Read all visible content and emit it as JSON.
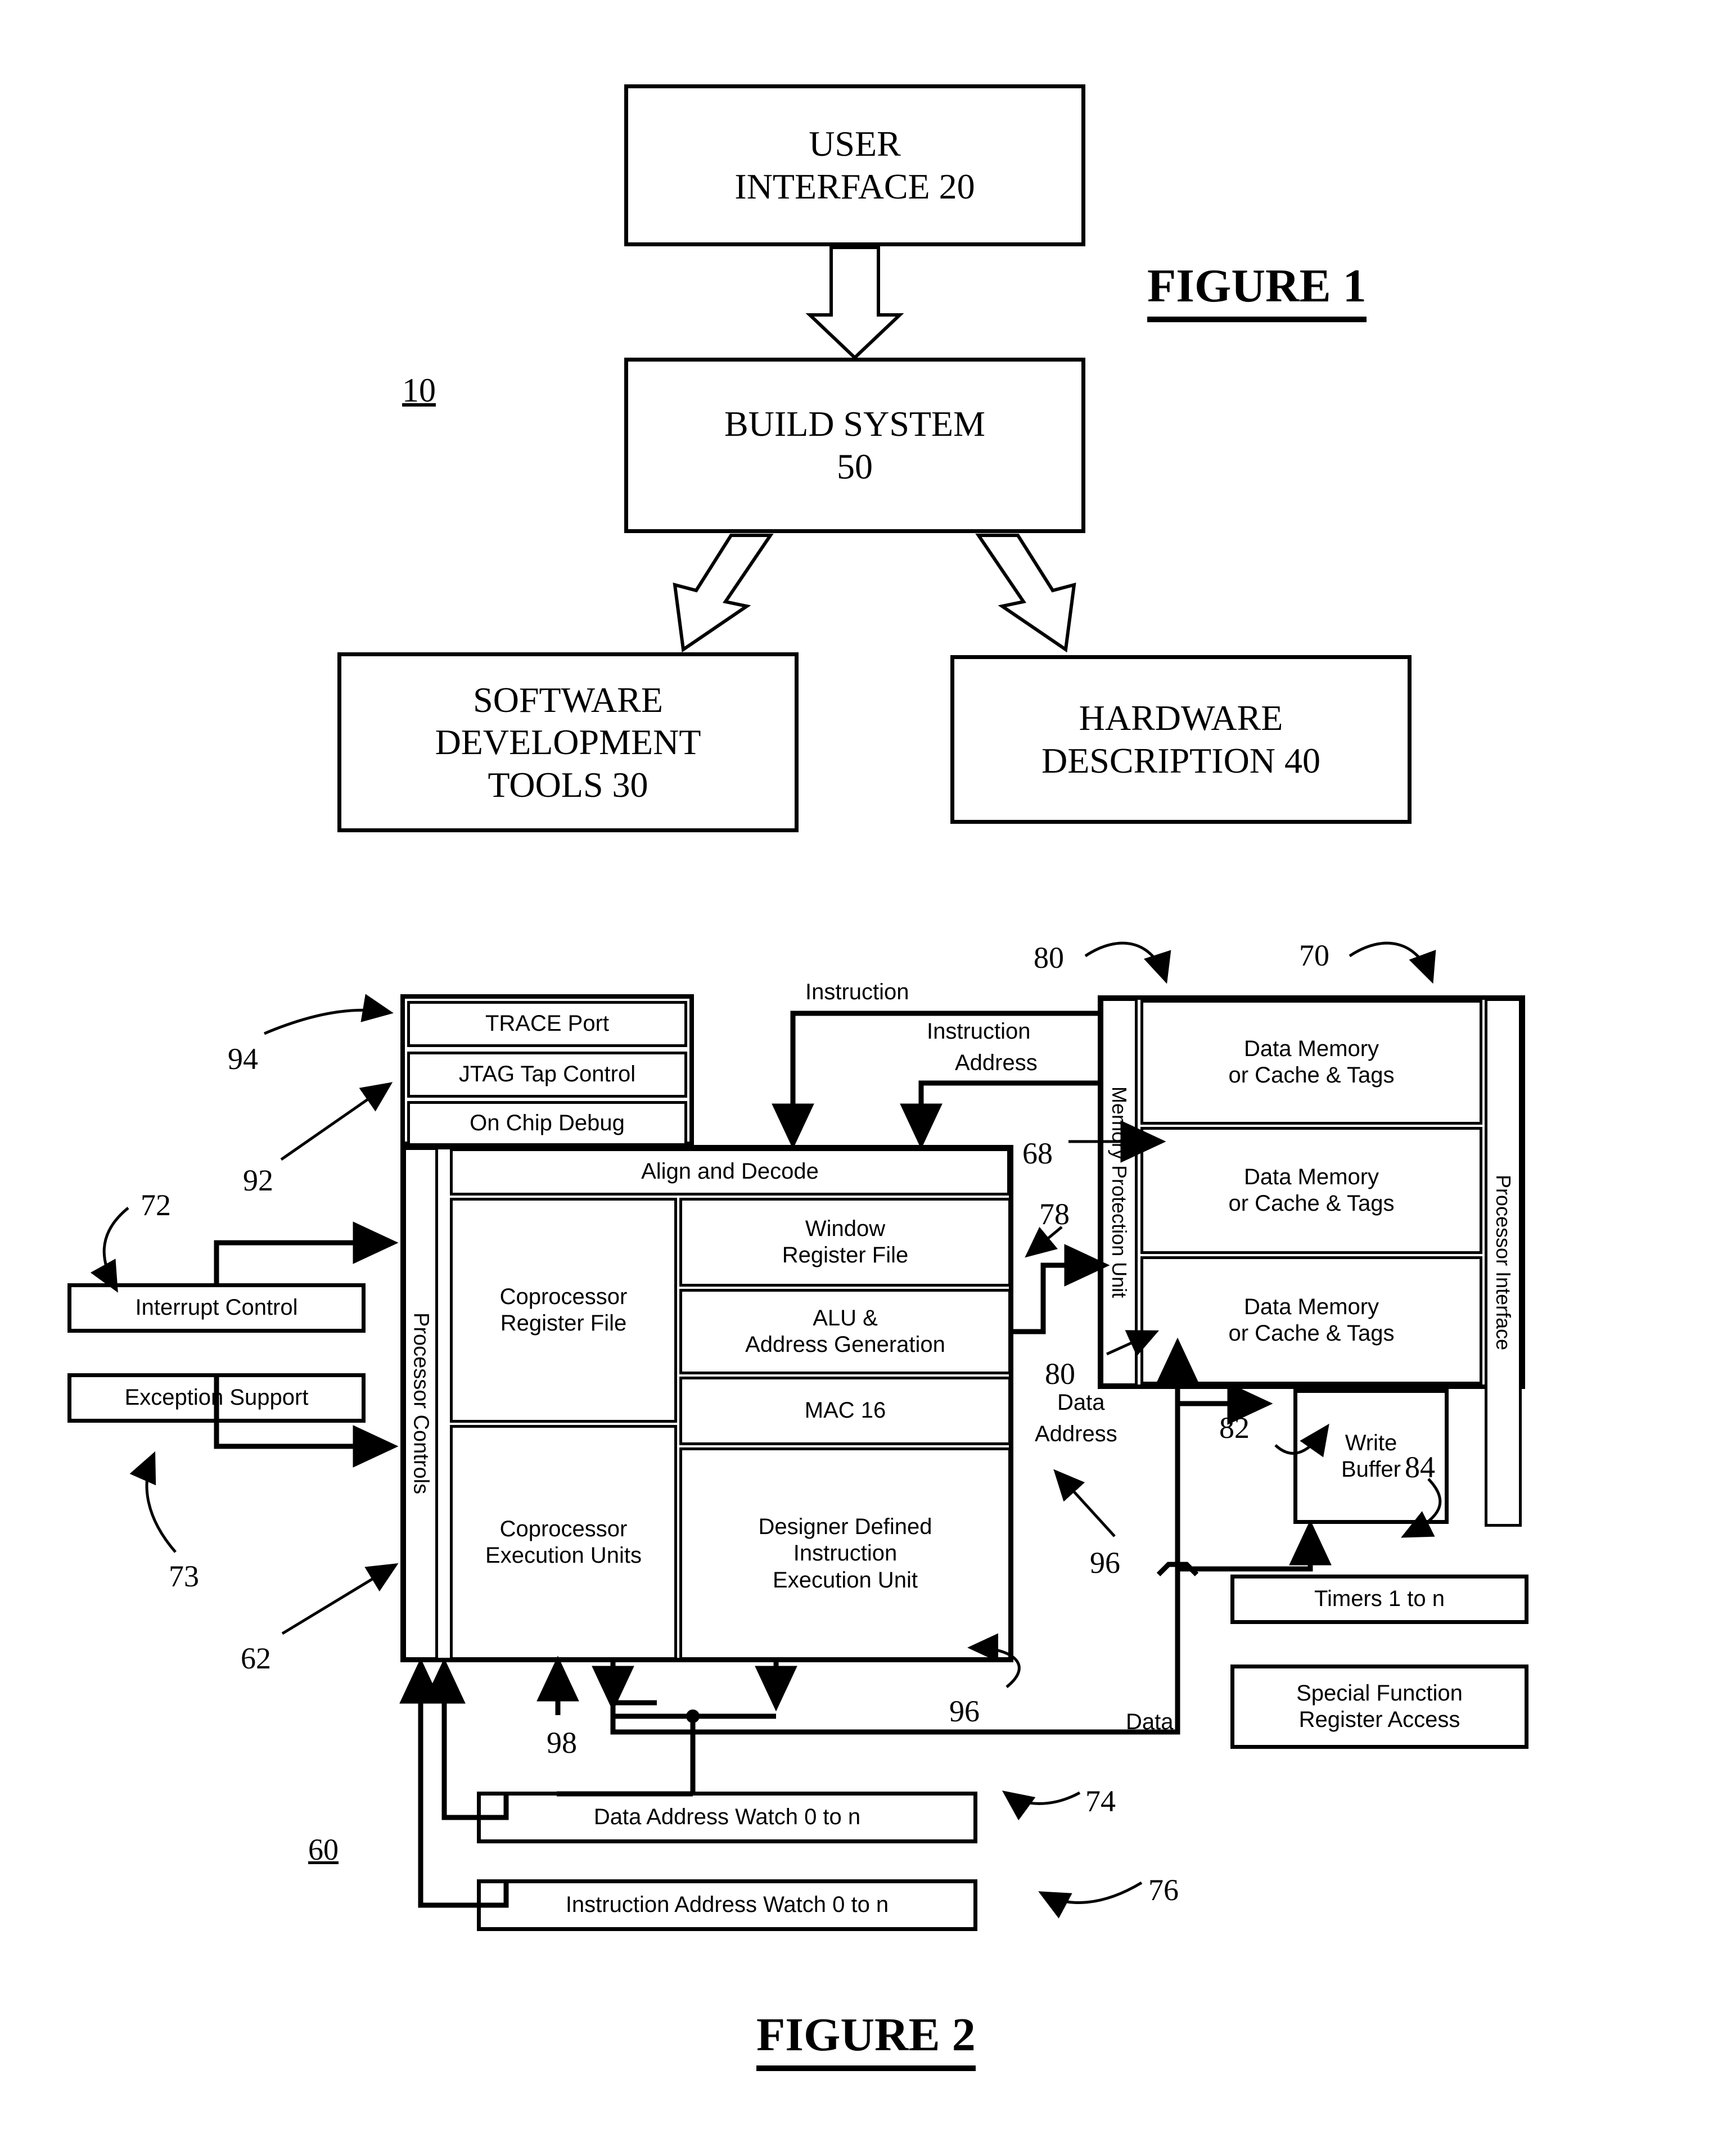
{
  "figure1": {
    "title": "FIGURE 1",
    "ref_system": "10",
    "boxes": {
      "user_interface": "USER\nINTERFACE 20",
      "user_interface_l1": "USER",
      "user_interface_l2": "INTERFACE 20",
      "build_system_l1": "BUILD SYSTEM",
      "build_system_l2": "50",
      "software_tools_l1": "SOFTWARE",
      "software_tools_l2": "DEVELOPMENT",
      "software_tools_l3": "TOOLS 30",
      "hardware_desc_l1": "HARDWARE",
      "hardware_desc_l2": "DESCRIPTION 40"
    }
  },
  "figure2": {
    "title": "FIGURE 2",
    "ref_processor": "60",
    "debug": {
      "trace_port": "TRACE Port",
      "jtag_tap_control": "JTAG Tap Control",
      "on_chip_debug": "On Chip Debug"
    },
    "core": {
      "processor_controls": "Processor Controls",
      "align_and_decode": "Align and Decode",
      "coprocessor_register_file_l1": "Coprocessor",
      "coprocessor_register_file_l2": "Register File",
      "coprocessor_execution_units_l1": "Coprocessor",
      "coprocessor_execution_units_l2": "Execution Units",
      "window_register_file_l1": "Window",
      "window_register_file_l2": "Register File",
      "alu_address_generation_l1": "ALU &",
      "alu_address_generation_l2": "Address Generation",
      "mac16": "MAC 16",
      "designer_defined_l1": "Designer Defined",
      "designer_defined_l2": "Instruction",
      "designer_defined_l3": "Execution Unit"
    },
    "memory": {
      "memory_protection_unit": "Memory Protection Unit",
      "processor_interface": "Processor Interface",
      "data_memory_1_l1": "Data Memory",
      "data_memory_1_l2": "or Cache & Tags",
      "data_memory_2_l1": "Data Memory",
      "data_memory_2_l2": "or Cache & Tags",
      "data_memory_3_l1": "Data Memory",
      "data_memory_3_l2": "or Cache & Tags",
      "write_buffer_l1": "Write",
      "write_buffer_l2": "Buffer"
    },
    "peripherals": {
      "timers": "Timers 1 to n",
      "special_function_l1": "Special Function",
      "special_function_l2": "Register Access",
      "data_address_watch": "Data Address Watch 0 to n",
      "instruction_address_watch": "Instruction Address Watch 0 to n",
      "interrupt_control": "Interrupt Control",
      "exception_support": "Exception Support"
    },
    "signal_labels": {
      "instruction": "Instruction",
      "instruction_address_l1": "Instruction",
      "instruction_address_l2": "Address",
      "data_address_l1": "Data",
      "data_address_l2": "Address",
      "data": "Data"
    },
    "refs": {
      "r94": "94",
      "r92": "92",
      "r72": "72",
      "r73": "73",
      "r62": "62",
      "r80_top": "80",
      "r70": "70",
      "r68": "68",
      "r78": "78",
      "r80_data": "80",
      "r82": "82",
      "r84": "84",
      "r96_a": "96",
      "r96_b": "96",
      "r98": "98",
      "r74": "74",
      "r76": "76"
    }
  },
  "colors": {
    "ink": "#000000",
    "paper": "#ffffff"
  }
}
